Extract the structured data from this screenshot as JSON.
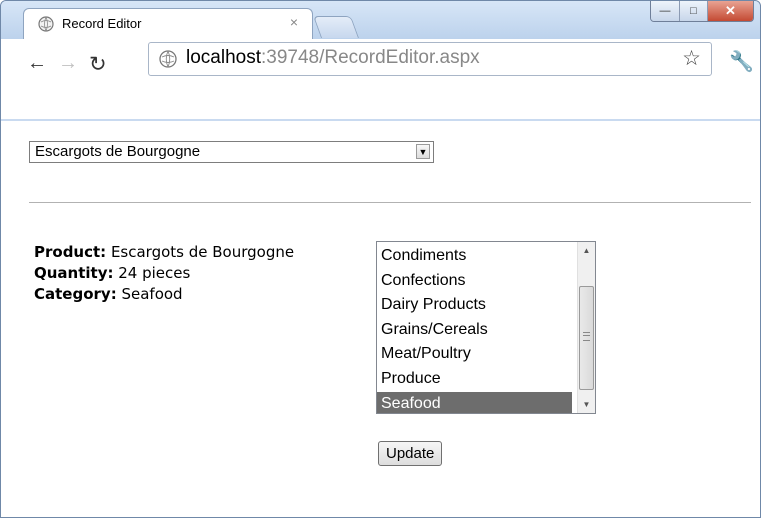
{
  "tab": {
    "title": "Record Editor",
    "close": "×"
  },
  "address_bar": {
    "host": "localhost",
    "rest": ":39748/RecordEditor.aspx"
  },
  "product_select": {
    "value": "Escargots de Bourgogne"
  },
  "details": {
    "product_label": "Product:",
    "product_value": " Escargots de Bourgogne",
    "quantity_label": "Quantity:",
    "quantity_value": " 24 pieces",
    "category_label": "Category:",
    "category_value": " Seafood"
  },
  "category_list": {
    "items": [
      "Condiments",
      "Confections",
      "Dairy Products",
      "Grains/Cereals",
      "Meat/Poultry",
      "Produce",
      "Seafood"
    ],
    "selected": "Seafood"
  },
  "update_button": {
    "label": "Update"
  }
}
